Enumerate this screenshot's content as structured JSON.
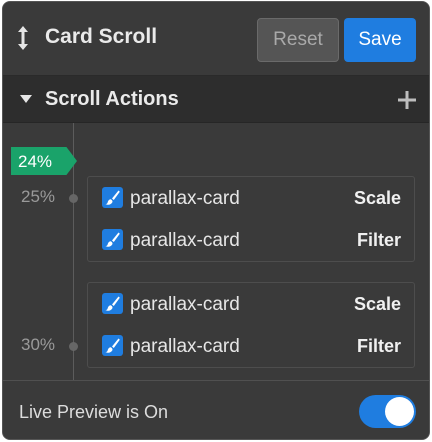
{
  "header": {
    "title": "Card Scroll",
    "reset_label": "Reset",
    "save_label": "Save"
  },
  "section": {
    "label": "Scroll Actions"
  },
  "timeline": {
    "current_marker": "24%",
    "groups": [
      {
        "percent": "25%",
        "rows": [
          {
            "checked": true,
            "name": "parallax-card",
            "action": "Scale"
          },
          {
            "checked": true,
            "name": "parallax-card",
            "action": "Filter"
          }
        ]
      },
      {
        "percent": "30%",
        "rows": [
          {
            "checked": true,
            "name": "parallax-card",
            "action": "Scale"
          },
          {
            "checked": true,
            "name": "parallax-card",
            "action": "Filter"
          }
        ]
      }
    ]
  },
  "footer": {
    "label": "Live Preview is On",
    "toggle_on": true
  },
  "colors": {
    "accent": "#1f7de0",
    "marker": "#1aa36a",
    "panel": "#3a3a3a"
  }
}
